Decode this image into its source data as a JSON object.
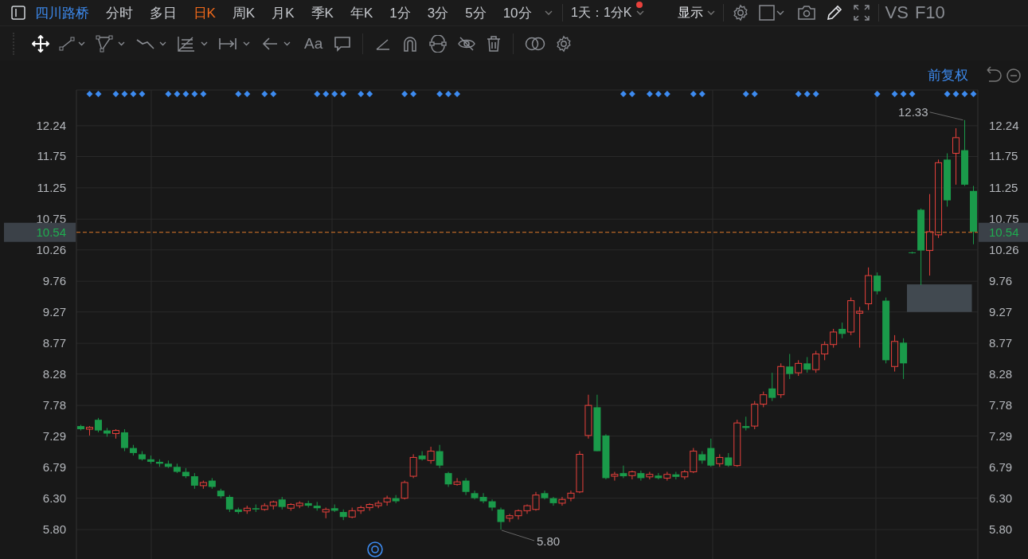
{
  "toolbar": {
    "stock": "四川路桥",
    "tabs": [
      {
        "label": "分时",
        "selected": false
      },
      {
        "label": "多日",
        "selected": false
      },
      {
        "label": "日K",
        "selected": true
      },
      {
        "label": "周K",
        "selected": false
      },
      {
        "label": "月K",
        "selected": false
      },
      {
        "label": "季K",
        "selected": false
      },
      {
        "label": "年K",
        "selected": false
      },
      {
        "label": "1分",
        "selected": false
      },
      {
        "label": "3分",
        "selected": false
      },
      {
        "label": "5分",
        "selected": false
      },
      {
        "label": "10分",
        "selected": false
      }
    ],
    "period": {
      "label": "1天：1分K",
      "alert": true
    },
    "display": "显示",
    "vs": "VS",
    "f10": "F10"
  },
  "drawing_toolbar": {
    "text_tool": "Aa"
  },
  "adjust": "前复权",
  "right_axis": {
    "labels": [
      "12.24",
      "11.75",
      "11.25",
      "10.75",
      "10.26",
      "9.76",
      "9.27",
      "8.77",
      "8.28",
      "7.78",
      "7.29",
      "6.79",
      "6.30",
      "5.80"
    ],
    "price_tag": "10.54"
  },
  "signal_marks": [
    false,
    true,
    true,
    false,
    true,
    true,
    true,
    true,
    false,
    false,
    true,
    true,
    true,
    true,
    true,
    false,
    false,
    false,
    true,
    true,
    false,
    true,
    true,
    false,
    false,
    false,
    false,
    true,
    true,
    true,
    true,
    false,
    true,
    true,
    false,
    false,
    false,
    true,
    true,
    false,
    false,
    true,
    true,
    true,
    false,
    false,
    false,
    false,
    false,
    false,
    false,
    false,
    false,
    false,
    false,
    false,
    false,
    false,
    false,
    false,
    false,
    false,
    true,
    true,
    false,
    true,
    true,
    true,
    false,
    false,
    true,
    true,
    false,
    false,
    false,
    false,
    true,
    true,
    false,
    false,
    false,
    false,
    true,
    true,
    true,
    false,
    false,
    false,
    false,
    false,
    false,
    true,
    false,
    true,
    true,
    true,
    false,
    false,
    false,
    true,
    true,
    true,
    true
  ],
  "chart_data": {
    "type": "candlestick",
    "ylim": [
      5.33,
      12.81
    ],
    "grid": true,
    "yticks": [
      {
        "value": 12.24,
        "label": "12.24"
      },
      {
        "value": 11.75,
        "label": "11.75"
      },
      {
        "value": 11.25,
        "label": "11.25"
      },
      {
        "value": 10.75,
        "label": "10.75"
      },
      {
        "value": 10.26,
        "label": "10.26"
      },
      {
        "value": 9.76,
        "label": "9.76"
      },
      {
        "value": 9.27,
        "label": "9.27"
      },
      {
        "value": 8.77,
        "label": "8.77"
      },
      {
        "value": 8.28,
        "label": "8.28"
      },
      {
        "value": 7.78,
        "label": "7.78"
      },
      {
        "value": 7.29,
        "label": "7.29"
      },
      {
        "value": 6.79,
        "label": "6.79"
      },
      {
        "value": 6.3,
        "label": "6.30"
      },
      {
        "value": 5.8,
        "label": "5.80"
      }
    ],
    "categories": [
      null,
      null,
      null,
      null,
      null,
      null,
      null,
      null,
      null,
      null,
      null,
      null,
      null,
      null,
      null,
      null,
      null,
      null,
      null,
      null,
      null,
      null,
      null,
      null,
      null,
      null,
      null,
      null,
      null,
      null,
      null,
      null,
      null,
      null,
      null,
      null,
      null,
      null,
      null,
      null,
      null,
      null,
      null,
      null,
      null,
      null,
      null,
      null,
      null,
      null,
      null,
      null,
      null,
      null,
      null,
      null,
      null,
      null,
      null,
      null,
      null,
      null,
      null,
      null,
      null,
      null,
      null,
      null,
      null,
      null,
      null,
      null,
      null,
      null,
      null,
      null,
      null,
      null,
      null,
      null,
      null,
      null,
      null,
      null,
      null,
      null,
      null,
      null,
      null,
      null,
      null,
      null,
      null,
      null,
      null,
      null,
      null,
      null,
      null,
      null,
      null,
      null,
      null
    ],
    "ohlc": [
      [
        7.45,
        7.47,
        7.38,
        7.4
      ],
      [
        7.4,
        7.45,
        7.3,
        7.43
      ],
      [
        7.55,
        7.58,
        7.35,
        7.38
      ],
      [
        7.38,
        7.42,
        7.28,
        7.33
      ],
      [
        7.33,
        7.4,
        7.25,
        7.38
      ],
      [
        7.35,
        7.4,
        7.05,
        7.1
      ],
      [
        7.1,
        7.15,
        6.98,
        7.02
      ],
      [
        7.0,
        7.05,
        6.9,
        6.92
      ],
      [
        6.92,
        6.98,
        6.85,
        6.88
      ],
      [
        6.88,
        6.92,
        6.8,
        6.85
      ],
      [
        6.85,
        6.9,
        6.78,
        6.8
      ],
      [
        6.8,
        6.85,
        6.7,
        6.72
      ],
      [
        6.72,
        6.78,
        6.62,
        6.65
      ],
      [
        6.65,
        6.7,
        6.45,
        6.5
      ],
      [
        6.5,
        6.58,
        6.45,
        6.55
      ],
      [
        6.58,
        6.62,
        6.45,
        6.48
      ],
      [
        6.42,
        6.45,
        6.3,
        6.33
      ],
      [
        6.32,
        6.35,
        6.08,
        6.12
      ],
      [
        6.12,
        6.15,
        6.05,
        6.08
      ],
      [
        6.1,
        6.18,
        6.05,
        6.14
      ],
      [
        6.14,
        6.2,
        6.08,
        6.12
      ],
      [
        6.12,
        6.22,
        6.1,
        6.18
      ],
      [
        6.18,
        6.26,
        6.12,
        6.24
      ],
      [
        6.28,
        6.32,
        6.12,
        6.16
      ],
      [
        6.14,
        6.22,
        6.1,
        6.2
      ],
      [
        6.18,
        6.25,
        6.14,
        6.22
      ],
      [
        6.22,
        6.26,
        6.15,
        6.18
      ],
      [
        6.18,
        6.24,
        6.1,
        6.14
      ],
      [
        6.08,
        6.15,
        5.98,
        6.12
      ],
      [
        6.14,
        6.2,
        6.08,
        6.1
      ],
      [
        6.08,
        6.12,
        5.95,
        6.0
      ],
      [
        6.0,
        6.15,
        5.98,
        6.1
      ],
      [
        6.1,
        6.18,
        6.05,
        6.15
      ],
      [
        6.15,
        6.22,
        6.1,
        6.2
      ],
      [
        6.18,
        6.26,
        6.14,
        6.22
      ],
      [
        6.24,
        6.34,
        6.18,
        6.3
      ],
      [
        6.3,
        6.35,
        6.22,
        6.25
      ],
      [
        6.3,
        6.58,
        6.28,
        6.55
      ],
      [
        6.65,
        7.0,
        6.62,
        6.95
      ],
      [
        6.98,
        7.05,
        6.9,
        6.92
      ],
      [
        6.9,
        7.12,
        6.85,
        7.05
      ],
      [
        7.05,
        7.15,
        6.78,
        6.82
      ],
      [
        6.7,
        6.72,
        6.48,
        6.52
      ],
      [
        6.52,
        6.62,
        6.5,
        6.56
      ],
      [
        6.58,
        6.62,
        6.35,
        6.4
      ],
      [
        6.38,
        6.42,
        6.28,
        6.3
      ],
      [
        6.32,
        6.38,
        6.22,
        6.25
      ],
      [
        6.25,
        6.28,
        6.1,
        6.15
      ],
      [
        6.12,
        6.15,
        5.8,
        5.92
      ],
      [
        5.98,
        6.05,
        5.92,
        6.02
      ],
      [
        6.02,
        6.12,
        5.96,
        6.1
      ],
      [
        6.1,
        6.2,
        6.05,
        6.18
      ],
      [
        6.12,
        6.4,
        6.1,
        6.35
      ],
      [
        6.38,
        6.42,
        6.28,
        6.3
      ],
      [
        6.3,
        6.32,
        6.18,
        6.22
      ],
      [
        6.22,
        6.32,
        6.18,
        6.28
      ],
      [
        6.3,
        6.42,
        6.25,
        6.38
      ],
      [
        6.4,
        7.05,
        6.38,
        7.0
      ],
      [
        7.3,
        7.95,
        7.25,
        7.78
      ],
      [
        7.75,
        7.95,
        7.05,
        7.05
      ],
      [
        7.3,
        7.32,
        6.6,
        6.62
      ],
      [
        6.65,
        6.72,
        6.58,
        6.68
      ],
      [
        6.7,
        6.82,
        6.62,
        6.65
      ],
      [
        6.66,
        6.74,
        6.6,
        6.72
      ],
      [
        6.7,
        6.74,
        6.58,
        6.62
      ],
      [
        6.64,
        6.72,
        6.6,
        6.68
      ],
      [
        6.66,
        6.7,
        6.6,
        6.62
      ],
      [
        6.62,
        6.72,
        6.58,
        6.68
      ],
      [
        6.68,
        6.72,
        6.6,
        6.64
      ],
      [
        6.64,
        6.75,
        6.6,
        6.72
      ],
      [
        6.72,
        7.1,
        6.7,
        7.05
      ],
      [
        7.0,
        7.05,
        6.85,
        6.9
      ],
      [
        7.1,
        7.25,
        6.8,
        6.82
      ],
      [
        6.85,
        7.0,
        6.8,
        6.95
      ],
      [
        6.95,
        7.02,
        6.8,
        6.82
      ],
      [
        6.82,
        7.55,
        6.8,
        7.5
      ],
      [
        7.45,
        7.6,
        7.38,
        7.42
      ],
      [
        7.45,
        7.85,
        7.4,
        7.8
      ],
      [
        7.8,
        8.0,
        7.75,
        7.95
      ],
      [
        8.05,
        8.3,
        7.85,
        7.9
      ],
      [
        7.95,
        8.45,
        7.9,
        8.4
      ],
      [
        8.4,
        8.6,
        8.2,
        8.28
      ],
      [
        8.3,
        8.5,
        8.25,
        8.45
      ],
      [
        8.45,
        8.55,
        8.3,
        8.35
      ],
      [
        8.35,
        8.65,
        8.3,
        8.6
      ],
      [
        8.6,
        8.8,
        8.5,
        8.75
      ],
      [
        8.75,
        9.0,
        8.7,
        8.95
      ],
      [
        9.0,
        9.1,
        8.85,
        8.92
      ],
      [
        8.95,
        9.5,
        8.9,
        9.45
      ],
      [
        9.25,
        9.35,
        8.7,
        9.28
      ],
      [
        9.4,
        9.98,
        9.3,
        9.85
      ],
      [
        9.85,
        9.9,
        9.55,
        9.6
      ],
      [
        9.45,
        9.5,
        8.45,
        8.5
      ],
      [
        8.4,
        8.9,
        8.32,
        8.8
      ],
      [
        8.78,
        8.85,
        8.2,
        8.45
      ],
      [
        10.22,
        10.23,
        10.2,
        10.21
      ],
      [
        10.9,
        10.92,
        9.7,
        10.25
      ],
      [
        10.25,
        11.15,
        9.85,
        10.55
      ],
      [
        10.5,
        11.7,
        10.45,
        11.65
      ],
      [
        11.7,
        11.8,
        10.95,
        11.05
      ],
      [
        11.8,
        12.2,
        11.3,
        12.05
      ],
      [
        11.85,
        12.33,
        11.28,
        11.3
      ],
      [
        11.2,
        11.28,
        10.35,
        10.55
      ]
    ],
    "ref_lines": [
      {
        "axis": "y",
        "value": 10.54,
        "label": "10.54"
      }
    ],
    "bands": [
      {
        "axis": "y",
        "from": 9.27,
        "to": 9.71
      }
    ],
    "annotations": [
      "12.33",
      "5.80"
    ]
  }
}
